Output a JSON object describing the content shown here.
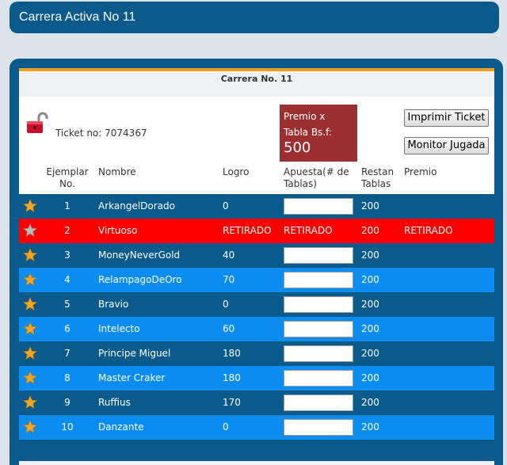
{
  "header": {
    "title": "Carrera Activa No 11"
  },
  "race": {
    "title": "Carrera No. 11"
  },
  "ticket": {
    "label": "Ticket no:",
    "number": "7074367"
  },
  "premio": {
    "label_line1": "Premio x",
    "label_line2": "Tabla Bs.f:",
    "amount": "500"
  },
  "buttons": {
    "print": "Imprimir Ticket",
    "monitor": "Monitor Jugada"
  },
  "columns": {
    "ejemplar_1": "Ejemplar",
    "ejemplar_2": "No.",
    "nombre": "Nombre",
    "logro": "Logro",
    "apuesta_1": "Apuesta(# de",
    "apuesta_2": "Tablas)",
    "restan_1": "Restan",
    "restan_2": "Tablas",
    "premio": "Premio"
  },
  "colors": {
    "header_bg": "#0a5a8c",
    "row_dark": "#0a5a8c",
    "row_light": "#0a8cf0",
    "row_withdrawn": "#ff0000",
    "premio_box": "#9c3030",
    "accent_line": "#f0a020"
  },
  "rows": [
    {
      "num": "1",
      "name": "ArkangelDorado",
      "logro": "0",
      "restan": "200",
      "premio": "",
      "withdrawn": false
    },
    {
      "num": "2",
      "name": "Virtuoso",
      "logro": "RETIRADO",
      "apuesta": "RETIRADO",
      "restan": "200",
      "premio": "RETIRADO",
      "withdrawn": true
    },
    {
      "num": "3",
      "name": "MoneyNeverGold",
      "logro": "40",
      "restan": "200",
      "premio": "",
      "withdrawn": false
    },
    {
      "num": "4",
      "name": "RelampagoDeOro",
      "logro": "70",
      "restan": "200",
      "premio": "",
      "withdrawn": false
    },
    {
      "num": "5",
      "name": "Bravio",
      "logro": "0",
      "restan": "200",
      "premio": "",
      "withdrawn": false
    },
    {
      "num": "6",
      "name": "Intelecto",
      "logro": "60",
      "restan": "200",
      "premio": "",
      "withdrawn": false
    },
    {
      "num": "7",
      "name": "Principe Miguel",
      "logro": "180",
      "restan": "200",
      "premio": "",
      "withdrawn": false
    },
    {
      "num": "8",
      "name": "Master Craker",
      "logro": "180",
      "restan": "200",
      "premio": "",
      "withdrawn": false
    },
    {
      "num": "9",
      "name": "Ruffius",
      "logro": "170",
      "restan": "200",
      "premio": "",
      "withdrawn": false
    },
    {
      "num": "10",
      "name": "Danzante",
      "logro": "0",
      "restan": "200",
      "premio": "",
      "withdrawn": false
    }
  ]
}
